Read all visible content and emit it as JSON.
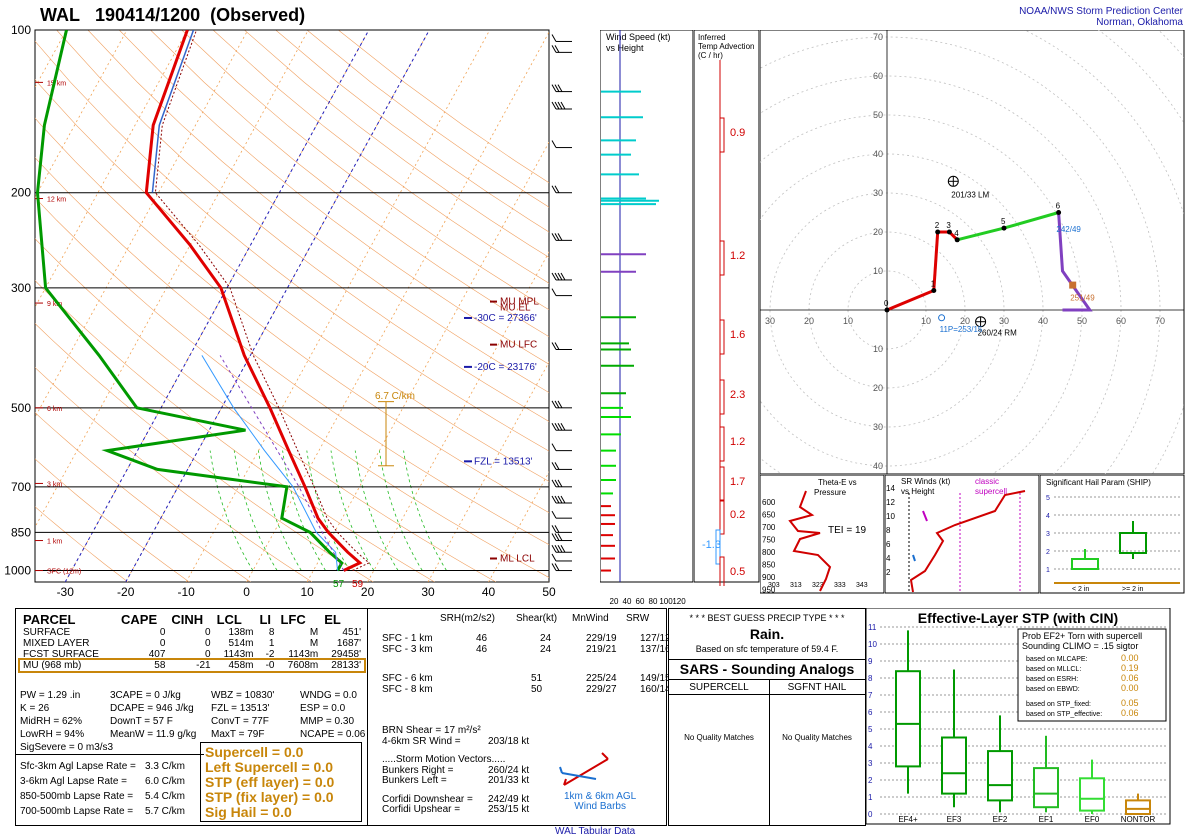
{
  "header": {
    "station": "WAL",
    "datetime": "190414/1200",
    "observed": "(Observed)",
    "org_line1": "NOAA/NWS Storm Prediction Center",
    "org_line2": "Norman, Oklahoma"
  },
  "skewt": {
    "pressure_ticks": [
      "100",
      "200",
      "300",
      "500",
      "700",
      "850",
      "1000"
    ],
    "height_marks": [
      "15 km",
      "12 km",
      "9 km",
      "6 km",
      "3 km",
      "1 km",
      "SFC (12m)"
    ],
    "temp_ticks": [
      "-30",
      "-20",
      "-10",
      "0",
      "10",
      "20",
      "30",
      "40",
      "50"
    ],
    "annotations": {
      "mu_mpl": "MU MPL",
      "mu_el": "MU EL",
      "m30c": "-30C = 27366'",
      "mu_lfc": "MU LFC",
      "m20c": "-20C = 23176'",
      "lapse": "6.7 C/km",
      "fzl": "FZL = 13513'",
      "ml_lcl": "ML LCL",
      "sfc_td": "57",
      "sfc_t": "59"
    }
  },
  "wind_speed": {
    "title1": "Wind Speed (kt)",
    "title2": "vs Height",
    "axis": [
      "20",
      "40",
      "60",
      "80",
      "100",
      "120"
    ]
  },
  "temp_adv": {
    "title1": "Inferred",
    "title2": "Temp Advection",
    "title3": "(C / hr)",
    "values": [
      "0.9",
      "1.2",
      "1.6",
      "2.3",
      "1.2",
      "1.7",
      "0.2",
      "-1.3",
      "0.5"
    ]
  },
  "hodograph": {
    "rings": [
      "10",
      "20",
      "30",
      "40",
      "50",
      "60",
      "70",
      "80",
      "90"
    ],
    "xlabels": [
      "40",
      "30",
      "20",
      "10",
      "10",
      "20",
      "30",
      "40",
      "50",
      "60",
      "70",
      "80",
      "90"
    ],
    "points": [
      "0",
      "1",
      "2",
      "3",
      "4",
      "5",
      "6"
    ],
    "lm": "201/33 LM",
    "rm": "260/24 RM",
    "upshear": "242/49",
    "downshear": "251/49",
    "effective": "11P=253/15"
  },
  "theta_e": {
    "title1": "Theta-E vs",
    "title2": "Pressure",
    "tei": "TEI = 19",
    "yticks": [
      "600",
      "650",
      "700",
      "750",
      "800",
      "850",
      "900",
      "950"
    ],
    "xticks": [
      "303",
      "313",
      "323",
      "333",
      "343"
    ]
  },
  "sr_winds": {
    "title1": "SR Winds (kt)",
    "title2": "vs Height",
    "classic1": "classic",
    "classic2": "supercell",
    "yticks": [
      "14",
      "12",
      "10",
      "8",
      "6",
      "4",
      "2"
    ]
  },
  "ship": {
    "title": "Significant Hail Param (SHIP)",
    "yticks": [
      "5",
      "4",
      "3",
      "2",
      "1"
    ],
    "cat1": "< 2 in",
    "cat2": ">= 2 in"
  },
  "parcels": {
    "headers": [
      "PARCEL",
      "CAPE",
      "CINH",
      "LCL",
      "LI",
      "LFC",
      "EL"
    ],
    "rows": [
      [
        "SURFACE",
        "0",
        "0",
        "138m",
        "8",
        "M",
        "451'"
      ],
      [
        "MIXED LAYER",
        "0",
        "0",
        "514m",
        "1",
        "M",
        "1687'"
      ],
      [
        "FCST SURFACE",
        "407",
        "0",
        "1143m",
        "-2",
        "1143m",
        "29458'"
      ],
      [
        "MU   (968 mb)",
        "58",
        "-21",
        "458m",
        "-0",
        "7608m",
        "28133'"
      ]
    ]
  },
  "indices": {
    "col1": [
      "PW = 1.29 .in",
      "K = 26",
      "MidRH = 62%",
      "LowRH = 94%",
      "SigSevere = 0 m3/s3"
    ],
    "col2": [
      "3CAPE = 0 J/kg",
      "DCAPE = 946 J/kg",
      "DownT = 57 F",
      "MeanW = 11.9 g/kg"
    ],
    "col3": [
      "WBZ = 10830'",
      "FZL = 13513'",
      "ConvT = 77F",
      "MaxT = 79F"
    ],
    "col4": [
      "WNDG = 0.0",
      "ESP = 0.0",
      "MMP = 0.30",
      "NCAPE = 0.06"
    ]
  },
  "lapse_rates": [
    [
      "Sfc-3km Agl Lapse Rate =",
      "3.3 C/km"
    ],
    [
      "3-6km Agl Lapse Rate =",
      "6.0 C/km"
    ],
    [
      "850-500mb Lapse Rate =",
      "5.4 C/km"
    ],
    [
      "700-500mb Lapse Rate =",
      "5.7 C/km"
    ]
  ],
  "composites": [
    "Supercell = 0.0",
    "Left Supercell = 0.0",
    "STP (eff layer) = 0.0",
    "STP (fix layer) = 0.0",
    "Sig Hail = 0.0"
  ],
  "kinematics": {
    "headers": [
      "SRH(m2/s2)",
      "Shear(kt)",
      "MnWind",
      "SRW"
    ],
    "rows": [
      [
        "SFC - 1 km",
        "46",
        "24",
        "229/19",
        "127/12"
      ],
      [
        "SFC - 3 km",
        "46",
        "24",
        "219/21",
        "137/16"
      ],
      [
        "SFC - 6 km",
        "51",
        "225/24",
        "149/15"
      ],
      [
        "SFC - 8 km",
        "50",
        "229/27",
        "160/14"
      ]
    ],
    "brn": "BRN Shear = 17 m²/s²",
    "sr46": "4-6km SR Wind =",
    "sr46v": "203/18 kt",
    "smv": ".....Storm Motion Vectors.....",
    "br": "Bunkers Right =",
    "brv": "260/24 kt",
    "bl": "Bunkers Left =",
    "blv": "201/33 kt",
    "cd": "Corfidi Downshear =",
    "cdv": "242/49 kt",
    "cu": "Corfidi Upshear =",
    "cuv": "253/15 kt",
    "barbs1": "1km & 6km AGL",
    "barbs2": "Wind Barbs"
  },
  "precip": {
    "title": "* * * BEST GUESS PRECIP TYPE * * *",
    "value": "Rain.",
    "note": "Based on sfc temperature of 59.4 F."
  },
  "sars": {
    "title": "SARS - Sounding Analogs",
    "sup": "SUPERCELL",
    "hail": "SGFNT HAIL",
    "nm1": "No Quality Matches",
    "nm2": "No Quality Matches"
  },
  "stp": {
    "title": "Effective-Layer STP (with CIN)",
    "prob1": "Prob EF2+ Torn with supercell",
    "prob2": "Sounding CLIMO = .15 sigtor",
    "items": [
      [
        "based on MLCAPE:",
        "0.00"
      ],
      [
        "based on MLLCL:",
        "0.19"
      ],
      [
        "based on ESRH:",
        "0.06"
      ],
      [
        "based on EBWD:",
        "0.00"
      ],
      [
        "based on STP_fixed:",
        "0.05"
      ],
      [
        "based on STP_effective:",
        "0.06"
      ]
    ],
    "yticks": [
      "11",
      "10",
      "9",
      "8",
      "7",
      "6",
      "5",
      "4",
      "3",
      "2",
      "1",
      "0"
    ],
    "categories": [
      "EF4+",
      "EF3",
      "EF2",
      "EF1",
      "EF0",
      "NONTOR"
    ]
  },
  "footer": "WAL Tabular Data",
  "chart_data": [
    {
      "type": "line",
      "title": "WAL 190414/1200 (Observed)",
      "ylabel": "Pressure (mb)",
      "ylim": [
        1000,
        100
      ],
      "xlim": [
        -30,
        50
      ],
      "series": [
        {
          "name": "Temperature",
          "pressure": [
            1000,
            968,
            925,
            850,
            800,
            700,
            600,
            500,
            400,
            300,
            250,
            200,
            150,
            100
          ],
          "values": [
            15,
            17,
            14,
            9,
            6,
            1,
            -5,
            -12,
            -21,
            -31,
            -40,
            -52,
            -57,
            -60
          ]
        },
        {
          "name": "Dewpoint",
          "pressure": [
            1000,
            968,
            925,
            850,
            800,
            700,
            650,
            600,
            550,
            500,
            400,
            300,
            200,
            150,
            100
          ],
          "values": [
            14,
            14,
            11,
            6,
            0,
            -2,
            -25,
            -35,
            -14,
            -34,
            -45,
            -60,
            -70,
            -75,
            -80
          ]
        }
      ],
      "color_temp": "#e00000",
      "color_dewp": "#009900"
    },
    {
      "type": "scatter",
      "title": "Hodograph",
      "points": [
        {
          "label": "0",
          "u": 0,
          "v": 0
        },
        {
          "label": "1",
          "u": 12,
          "v": 5
        },
        {
          "label": "2",
          "u": 13,
          "v": 20
        },
        {
          "label": "3",
          "u": 16,
          "v": 20
        },
        {
          "label": "4",
          "u": 18,
          "v": 18
        },
        {
          "label": "5",
          "u": 30,
          "v": 21
        },
        {
          "label": "6",
          "u": 44,
          "v": 25
        }
      ],
      "xlim": [
        -40,
        90
      ],
      "ylim": [
        -50,
        90
      ]
    },
    {
      "type": "bar",
      "title": "Effective-Layer STP (with CIN)",
      "categories": [
        "EF4+",
        "EF3",
        "EF2",
        "EF1",
        "EF0",
        "NONTOR"
      ],
      "box_median": [
        5.3,
        2.4,
        1.7,
        1.2,
        0.9,
        0.3
      ],
      "box_q1": [
        2.8,
        1.2,
        0.8,
        0.4,
        0.2,
        0.0
      ],
      "box_q3": [
        8.4,
        4.5,
        3.7,
        2.7,
        2.1,
        0.8
      ],
      "box_min": [
        1.2,
        0.4,
        0.1,
        0.1,
        0.0,
        0.0
      ],
      "box_max": [
        10.8,
        8.5,
        5.8,
        4.6,
        3.2,
        1.2
      ],
      "ylim": [
        0,
        11
      ]
    }
  ]
}
